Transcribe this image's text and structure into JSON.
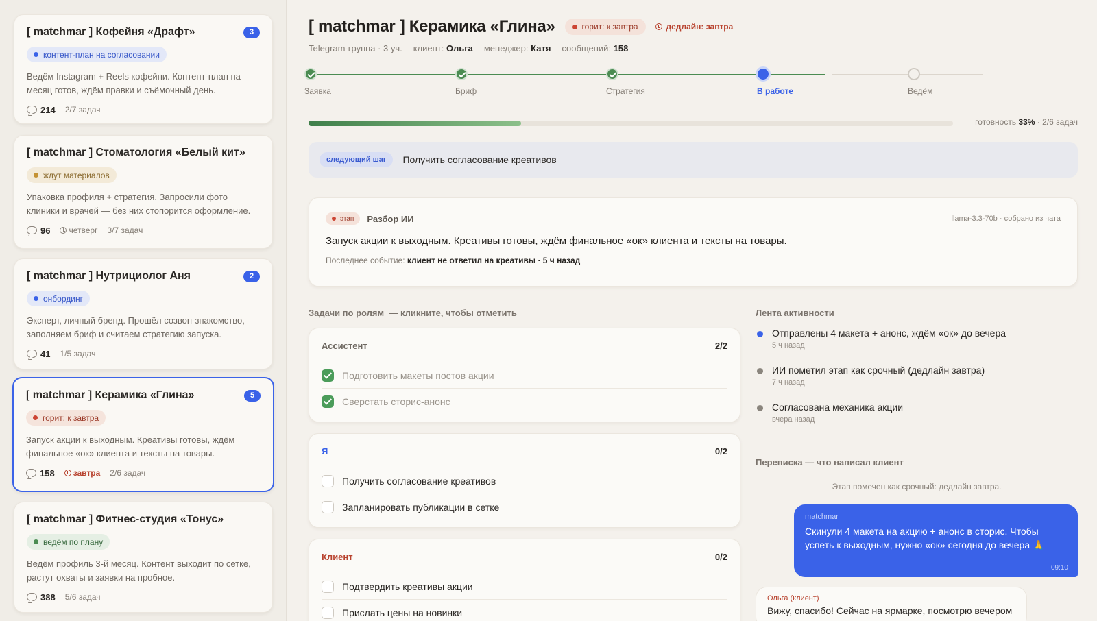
{
  "sidebar": {
    "cards": [
      {
        "title": "[ matchmar ] Кофейня «Драфт»",
        "badge": "3",
        "status": "контент-план на согласовании",
        "desc": "Ведём Instagram + Reels кофейни. Контент-план на месяц готов, ждём правки и съёмочный день.",
        "messages": "214",
        "due": "",
        "tasks": "2/7 задач"
      },
      {
        "title": "[ matchmar ] Стоматология «Белый кит»",
        "badge": "",
        "status": "ждут материалов",
        "desc": "Упаковка профиля + стратегия. Запросили фото клиники и врачей — без них стопорится оформление.",
        "messages": "96",
        "due": "четверг",
        "tasks": "3/7 задач"
      },
      {
        "title": "[ matchmar ] Нутрициолог Аня",
        "badge": "2",
        "status": "онбординг",
        "desc": "Эксперт, личный бренд. Прошёл созвон-знакомство, заполняем бриф и считаем стратегию запуска.",
        "messages": "41",
        "due": "",
        "tasks": "1/5 задач"
      },
      {
        "title": "[ matchmar ] Керамика «Глина»",
        "badge": "5",
        "status": "горит: к завтра",
        "desc": "Запуск акции к выходным. Креативы готовы, ждём финальное «ок» клиента и тексты на товары.",
        "messages": "158",
        "due": "завтра",
        "tasks": "2/6 задач"
      },
      {
        "title": "[ matchmar ] Фитнес-студия «Тонус»",
        "badge": "",
        "status": "ведём по плану",
        "desc": "Ведём профиль 3-й месяц. Контент выходит по сетке, растут охваты и заявки на пробное.",
        "messages": "388",
        "due": "",
        "tasks": "5/6 задач"
      }
    ]
  },
  "project": {
    "title": "[ matchmar ] Керамика «Глина»",
    "hot_label": "горит: к завтра",
    "deadline": "дедлайн: завтра",
    "meta_group": "Telegram-группа · 3 уч.",
    "client_label": "клиент:",
    "client": "Ольга",
    "manager_label": "менеджер:",
    "manager": "Катя",
    "messages_label": "сообщений:",
    "messages": "158"
  },
  "stepper": {
    "steps": [
      {
        "label": "Заявка",
        "state": "done"
      },
      {
        "label": "Бриф",
        "state": "done"
      },
      {
        "label": "Стратегия",
        "state": "done"
      },
      {
        "label": "В работе",
        "state": "current"
      },
      {
        "label": "Ведём",
        "state": "todo"
      }
    ]
  },
  "progress": {
    "percent": 33,
    "label": "готовность",
    "percent_text": "33%",
    "tasks": "· 2/6 задач"
  },
  "next_step": {
    "tag": "следующий шаг",
    "text": "Получить согласование креативов"
  },
  "ai": {
    "stage": "этап",
    "label": "Разбор ИИ",
    "model": "llama-3.3-70b · собрано из чата",
    "summary": "Запуск акции к выходным. Креативы готовы, ждём финальное «ок» клиента и тексты на товары.",
    "last_label": "Последнее событие:",
    "last_event": "клиент не ответил на креативы · 5 ч назад"
  },
  "tasks": {
    "title": "Задачи по ролям",
    "hint": "— кликните, чтобы отметить",
    "groups": [
      {
        "role": "Ассистент",
        "count": "2/2",
        "items": [
          {
            "text": "Подготовить макеты постов акции",
            "done": true
          },
          {
            "text": "Сверстать сторис-анонс",
            "done": true
          }
        ]
      },
      {
        "role": "Я",
        "count": "0/2",
        "items": [
          {
            "text": "Получить согласование креативов",
            "done": false
          },
          {
            "text": "Запланировать публикации в сетке",
            "done": false
          }
        ]
      },
      {
        "role": "Клиент",
        "count": "0/2",
        "items": [
          {
            "text": "Подтвердить креативы акции",
            "done": false
          },
          {
            "text": "Прислать цены на новинки",
            "done": false
          }
        ]
      }
    ]
  },
  "feed": {
    "title": "Лента активности",
    "items": [
      {
        "text": "Отправлены 4 макета + анонс, ждём «ок» до вечера",
        "time": "5 ч назад"
      },
      {
        "text": "ИИ пометил этап как срочный (дедлайн завтра)",
        "time": "7 ч назад"
      },
      {
        "text": "Согласована механика акции",
        "time": "вчера назад"
      }
    ]
  },
  "chat": {
    "title": "Переписка — что написал клиент",
    "system_note": "Этап помечен как срочный: дедлайн завтра.",
    "outgoing": {
      "author": "matchmar",
      "text": "Скинули 4 макета на акцию + анонс в сторис. Чтобы успеть к выходным, нужно «ок» сегодня до вечера 🙏",
      "time": "09:10"
    },
    "incoming": {
      "author": "Ольга (клиент)",
      "text": "Вижу, спасибо! Сейчас на ярмарке, посмотрю вечером"
    }
  },
  "colors": {
    "accent": "#3a62e8",
    "success": "#4b8c52",
    "danger": "#cc4433",
    "warning": "#c49235"
  }
}
